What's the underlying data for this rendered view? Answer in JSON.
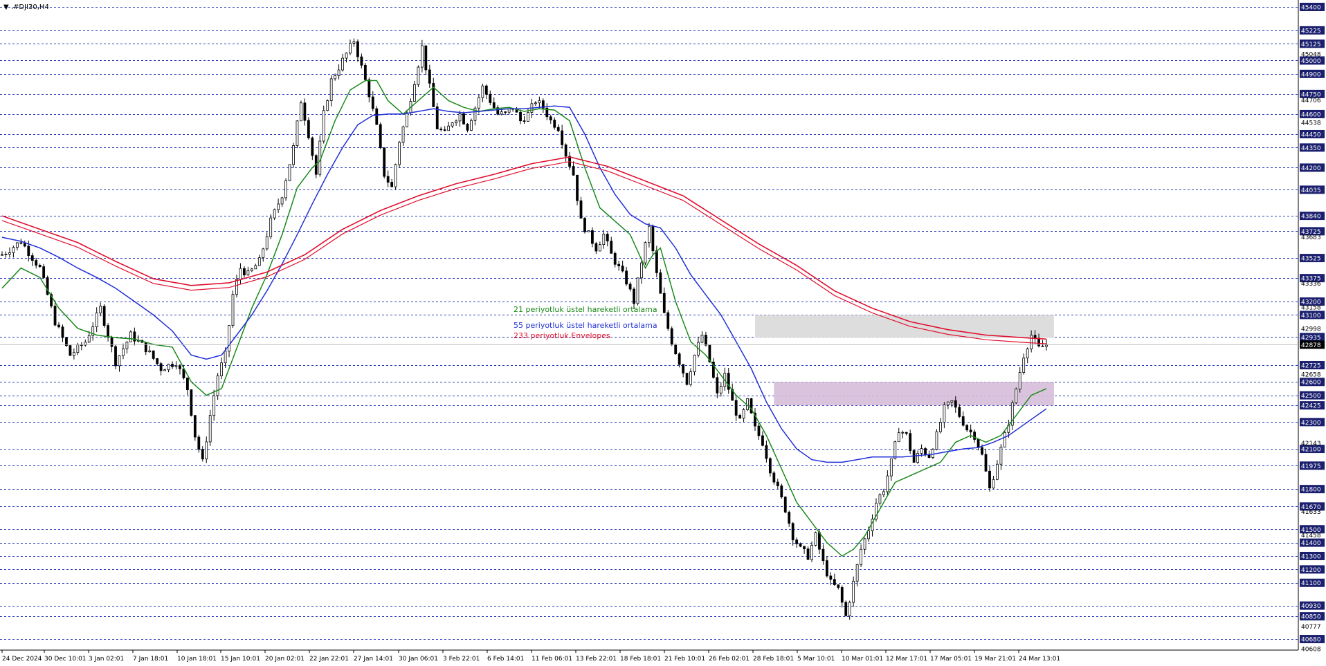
{
  "symbol": "▼ .#DJI30,H4",
  "colors": {
    "background": "#ffffff",
    "grid": "#2a3bb5",
    "candle": "#000000",
    "ema21": "#1a8a1a",
    "ema55": "#1f2fd6",
    "envelopes": "#e00f2d",
    "upper_zone": "#d9d9d9",
    "lower_zone": "#d6bcd8",
    "price_label_bg": "#1a1f6e",
    "current_price_bg": "#000000"
  },
  "legend": {
    "ema21": "21 periyotluk üstel hareketli ortalama",
    "ema55": "55 periyotluk üstel hareketli ortalama",
    "envelopes": "233 periyotluk Envelopes"
  },
  "chart_data": {
    "type": "candlestick",
    "title": "",
    "xlabel": "",
    "ylabel": "",
    "ylim": [
      40608,
      45400
    ],
    "grid": true,
    "y_axis_levels": [
      45400,
      45225,
      45125,
      45000,
      44900,
      44750,
      44600,
      44450,
      44350,
      44200,
      44035,
      43840,
      43725,
      43525,
      43375,
      43200,
      43100,
      42935,
      42725,
      42600,
      42500,
      42425,
      42300,
      42100,
      41975,
      41800,
      41670,
      41500,
      41400,
      41300,
      41200,
      41100,
      40930,
      40850,
      40680
    ],
    "y_axis_minor_labels": [
      45048,
      44706,
      44538,
      43683,
      43336,
      43158,
      42998,
      42658,
      42143,
      41633,
      41458,
      40777,
      40608
    ],
    "current_price": 42878,
    "x_tick_labels": [
      "24 Dec 2024",
      "30 Dec 10:01",
      "3 Jan 02:01",
      "7 Jan 18:01",
      "10 Jan 18:01",
      "15 Jan 10:01",
      "20 Jan 02:01",
      "22 Jan 22:01",
      "27 Jan 14:01",
      "30 Jan 06:01",
      "3 Feb 22:01",
      "6 Feb 14:01",
      "11 Feb 06:01",
      "13 Feb 22:01",
      "18 Feb 18:01",
      "21 Feb 10:01",
      "26 Feb 02:01",
      "28 Feb 18:01",
      "5 Mar 10:01",
      "10 Mar 01:01",
      "12 Mar 17:01",
      "17 Mar 05:01",
      "19 Mar 21:01",
      "24 Mar 13:01"
    ],
    "close_path": [
      [
        0,
        43550
      ],
      [
        5,
        43650
      ],
      [
        10,
        43450
      ],
      [
        14,
        43050
      ],
      [
        18,
        42800
      ],
      [
        22,
        42900
      ],
      [
        26,
        43150
      ],
      [
        30,
        42750
      ],
      [
        34,
        42950
      ],
      [
        38,
        42850
      ],
      [
        42,
        42700
      ],
      [
        46,
        42750
      ],
      [
        49,
        42550
      ],
      [
        51,
        42200
      ],
      [
        53,
        42000
      ],
      [
        55,
        42350
      ],
      [
        57,
        42650
      ],
      [
        59,
        42800
      ],
      [
        61,
        43250
      ],
      [
        63,
        43450
      ],
      [
        65,
        43400
      ],
      [
        68,
        43500
      ],
      [
        71,
        43800
      ],
      [
        74,
        44000
      ],
      [
        77,
        44350
      ],
      [
        79,
        44700
      ],
      [
        81,
        44450
      ],
      [
        83,
        44150
      ],
      [
        85,
        44600
      ],
      [
        87,
        44850
      ],
      [
        89,
        44950
      ],
      [
        91,
        45050
      ],
      [
        93,
        45150
      ],
      [
        95,
        44950
      ],
      [
        97,
        44750
      ],
      [
        99,
        44500
      ],
      [
        101,
        44150
      ],
      [
        103,
        44050
      ],
      [
        105,
        44400
      ],
      [
        107,
        44600
      ],
      [
        109,
        44850
      ],
      [
        111,
        45100
      ],
      [
        113,
        44800
      ],
      [
        115,
        44500
      ],
      [
        117,
        44450
      ],
      [
        119,
        44550
      ],
      [
        121,
        44600
      ],
      [
        123,
        44500
      ],
      [
        125,
        44650
      ],
      [
        127,
        44800
      ],
      [
        129,
        44700
      ],
      [
        131,
        44600
      ],
      [
        133,
        44600
      ],
      [
        135,
        44650
      ],
      [
        137,
        44550
      ],
      [
        139,
        44600
      ],
      [
        141,
        44700
      ],
      [
        143,
        44650
      ],
      [
        145,
        44550
      ],
      [
        147,
        44500
      ],
      [
        149,
        44300
      ],
      [
        151,
        44150
      ],
      [
        153,
        43800
      ],
      [
        155,
        43700
      ],
      [
        157,
        43600
      ],
      [
        159,
        43700
      ],
      [
        161,
        43550
      ],
      [
        163,
        43450
      ],
      [
        165,
        43350
      ],
      [
        167,
        43200
      ],
      [
        169,
        43500
      ],
      [
        171,
        43750
      ],
      [
        173,
        43400
      ],
      [
        175,
        43100
      ],
      [
        177,
        42900
      ],
      [
        179,
        42750
      ],
      [
        181,
        42600
      ],
      [
        183,
        42800
      ],
      [
        185,
        42950
      ],
      [
        187,
        42750
      ],
      [
        189,
        42500
      ],
      [
        191,
        42650
      ],
      [
        193,
        42450
      ],
      [
        195,
        42300
      ],
      [
        197,
        42450
      ],
      [
        199,
        42250
      ],
      [
        201,
        42150
      ],
      [
        203,
        41950
      ],
      [
        205,
        41800
      ],
      [
        207,
        41650
      ],
      [
        209,
        41450
      ],
      [
        211,
        41350
      ],
      [
        213,
        41300
      ],
      [
        215,
        41450
      ],
      [
        217,
        41250
      ],
      [
        219,
        41100
      ],
      [
        221,
        41050
      ],
      [
        223,
        40850
      ],
      [
        225,
        41100
      ],
      [
        227,
        41350
      ],
      [
        229,
        41500
      ],
      [
        231,
        41700
      ],
      [
        233,
        41800
      ],
      [
        235,
        42000
      ],
      [
        237,
        42250
      ],
      [
        239,
        42200
      ],
      [
        241,
        42000
      ],
      [
        243,
        42100
      ],
      [
        245,
        42050
      ],
      [
        247,
        42200
      ],
      [
        249,
        42400
      ],
      [
        251,
        42450
      ],
      [
        253,
        42350
      ],
      [
        255,
        42250
      ],
      [
        257,
        42200
      ],
      [
        259,
        42050
      ],
      [
        261,
        41800
      ],
      [
        262,
        41900
      ],
      [
        264,
        42100
      ],
      [
        266,
        42300
      ],
      [
        268,
        42550
      ],
      [
        270,
        42800
      ],
      [
        272,
        42950
      ],
      [
        274,
        42850
      ],
      [
        276,
        42878
      ]
    ],
    "series": [
      {
        "name": "21 periyotluk üstel hareketli ortalama",
        "values": [
          [
            0,
            43300
          ],
          [
            5,
            43450
          ],
          [
            10,
            43380
          ],
          [
            15,
            43150
          ],
          [
            20,
            43000
          ],
          [
            25,
            42950
          ],
          [
            30,
            42930
          ],
          [
            35,
            42920
          ],
          [
            40,
            42880
          ],
          [
            45,
            42860
          ],
          [
            50,
            42600
          ],
          [
            54,
            42500
          ],
          [
            58,
            42550
          ],
          [
            62,
            42850
          ],
          [
            66,
            43150
          ],
          [
            70,
            43400
          ],
          [
            74,
            43700
          ],
          [
            78,
            44050
          ],
          [
            82,
            44200
          ],
          [
            84,
            44250
          ],
          [
            88,
            44550
          ],
          [
            92,
            44780
          ],
          [
            96,
            44850
          ],
          [
            99,
            44850
          ],
          [
            102,
            44700
          ],
          [
            106,
            44600
          ],
          [
            110,
            44700
          ],
          [
            114,
            44800
          ],
          [
            118,
            44700
          ],
          [
            122,
            44650
          ],
          [
            126,
            44620
          ],
          [
            130,
            44640
          ],
          [
            134,
            44650
          ],
          [
            138,
            44620
          ],
          [
            142,
            44640
          ],
          [
            146,
            44630
          ],
          [
            150,
            44550
          ],
          [
            154,
            44200
          ],
          [
            158,
            43900
          ],
          [
            162,
            43800
          ],
          [
            166,
            43700
          ],
          [
            170,
            43450
          ],
          [
            172,
            43550
          ],
          [
            174,
            43600
          ],
          [
            178,
            43200
          ],
          [
            182,
            42900
          ],
          [
            186,
            42800
          ],
          [
            190,
            42650
          ],
          [
            194,
            42500
          ],
          [
            198,
            42400
          ],
          [
            202,
            42200
          ],
          [
            206,
            41950
          ],
          [
            210,
            41700
          ],
          [
            214,
            41550
          ],
          [
            218,
            41400
          ],
          [
            222,
            41300
          ],
          [
            225,
            41350
          ],
          [
            228,
            41450
          ],
          [
            232,
            41650
          ],
          [
            236,
            41850
          ],
          [
            240,
            41900
          ],
          [
            244,
            41950
          ],
          [
            248,
            42000
          ],
          [
            252,
            42150
          ],
          [
            256,
            42200
          ],
          [
            260,
            42150
          ],
          [
            264,
            42200
          ],
          [
            268,
            42350
          ],
          [
            272,
            42500
          ],
          [
            276,
            42550
          ]
        ]
      },
      {
        "name": "55 periyotluk üstel hareketli ortalama",
        "values": [
          [
            0,
            43680
          ],
          [
            5,
            43650
          ],
          [
            10,
            43600
          ],
          [
            15,
            43530
          ],
          [
            20,
            43450
          ],
          [
            25,
            43380
          ],
          [
            30,
            43300
          ],
          [
            35,
            43200
          ],
          [
            40,
            43100
          ],
          [
            45,
            42980
          ],
          [
            50,
            42800
          ],
          [
            54,
            42770
          ],
          [
            58,
            42800
          ],
          [
            62,
            42950
          ],
          [
            66,
            43100
          ],
          [
            70,
            43280
          ],
          [
            74,
            43480
          ],
          [
            78,
            43700
          ],
          [
            82,
            43930
          ],
          [
            86,
            44150
          ],
          [
            90,
            44350
          ],
          [
            94,
            44520
          ],
          [
            98,
            44590
          ],
          [
            102,
            44600
          ],
          [
            106,
            44600
          ],
          [
            110,
            44620
          ],
          [
            114,
            44640
          ],
          [
            118,
            44620
          ],
          [
            122,
            44610
          ],
          [
            126,
            44620
          ],
          [
            130,
            44630
          ],
          [
            134,
            44640
          ],
          [
            138,
            44640
          ],
          [
            142,
            44650
          ],
          [
            146,
            44660
          ],
          [
            150,
            44650
          ],
          [
            154,
            44450
          ],
          [
            158,
            44200
          ],
          [
            162,
            44000
          ],
          [
            166,
            43850
          ],
          [
            170,
            43780
          ],
          [
            174,
            43750
          ],
          [
            178,
            43600
          ],
          [
            182,
            43400
          ],
          [
            186,
            43250
          ],
          [
            190,
            43100
          ],
          [
            194,
            42900
          ],
          [
            198,
            42700
          ],
          [
            202,
            42450
          ],
          [
            206,
            42250
          ],
          [
            210,
            42100
          ],
          [
            214,
            42020
          ],
          [
            218,
            42000
          ],
          [
            222,
            42000
          ],
          [
            226,
            42020
          ],
          [
            230,
            42040
          ],
          [
            234,
            42040
          ],
          [
            238,
            42040
          ],
          [
            242,
            42050
          ],
          [
            246,
            42060
          ],
          [
            250,
            42080
          ],
          [
            254,
            42100
          ],
          [
            258,
            42110
          ],
          [
            262,
            42150
          ],
          [
            266,
            42200
          ],
          [
            270,
            42280
          ],
          [
            276,
            42400
          ]
        ]
      },
      {
        "name": "233 periyotluk Envelopes",
        "values": [
          [
            0,
            43840
          ],
          [
            10,
            43740
          ],
          [
            20,
            43640
          ],
          [
            30,
            43500
          ],
          [
            40,
            43370
          ],
          [
            50,
            43320
          ],
          [
            60,
            43340
          ],
          [
            70,
            43420
          ],
          [
            80,
            43550
          ],
          [
            90,
            43740
          ],
          [
            100,
            43880
          ],
          [
            110,
            43990
          ],
          [
            120,
            44080
          ],
          [
            130,
            44150
          ],
          [
            140,
            44230
          ],
          [
            150,
            44280
          ],
          [
            160,
            44210
          ],
          [
            170,
            44100
          ],
          [
            180,
            43990
          ],
          [
            190,
            43810
          ],
          [
            200,
            43630
          ],
          [
            210,
            43470
          ],
          [
            220,
            43280
          ],
          [
            230,
            43150
          ],
          [
            240,
            43050
          ],
          [
            250,
            42990
          ],
          [
            260,
            42950
          ],
          [
            270,
            42930
          ],
          [
            276,
            42920
          ]
        ]
      }
    ],
    "zones": [
      {
        "name": "resistance",
        "from_index": 199,
        "to_index": 278,
        "low": 42930,
        "high": 43100
      },
      {
        "name": "support",
        "from_index": 204,
        "to_index": 278,
        "low": 42425,
        "high": 42600
      }
    ]
  }
}
